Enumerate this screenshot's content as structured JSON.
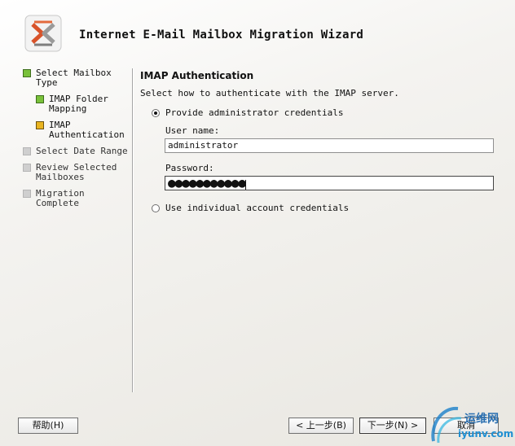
{
  "header": {
    "title": "Internet E-Mail Mailbox Migration Wizard",
    "logo_icon": "exchange-logo-icon"
  },
  "steps": [
    {
      "label": "Select Mailbox Type",
      "state": "done"
    },
    {
      "label": "IMAP Folder Mapping",
      "state": "done",
      "sub": true
    },
    {
      "label": "IMAP Authentication",
      "state": "current",
      "sub": true
    },
    {
      "label": "Select Date Range",
      "state": "todo"
    },
    {
      "label": "Review Selected Mailboxes",
      "state": "todo"
    },
    {
      "label": "Migration Complete",
      "state": "todo"
    }
  ],
  "content": {
    "section_title": "IMAP Authentication",
    "instruction": "Select how to authenticate with the IMAP server.",
    "option_admin": {
      "label": "Provide administrator credentials",
      "checked": true
    },
    "username_label": "User name:",
    "username_value": "administrator",
    "password_label": "Password:",
    "password_mask": "●●●●●●●●●●●",
    "option_individual": {
      "label": "Use individual account credentials",
      "checked": false
    }
  },
  "buttons": {
    "help": "帮助(H)",
    "back": "< 上一步(B)",
    "next": "下一步(N) >",
    "cancel": "取消"
  },
  "watermark": {
    "line1": "运维网",
    "line2": "iyunv.com"
  }
}
